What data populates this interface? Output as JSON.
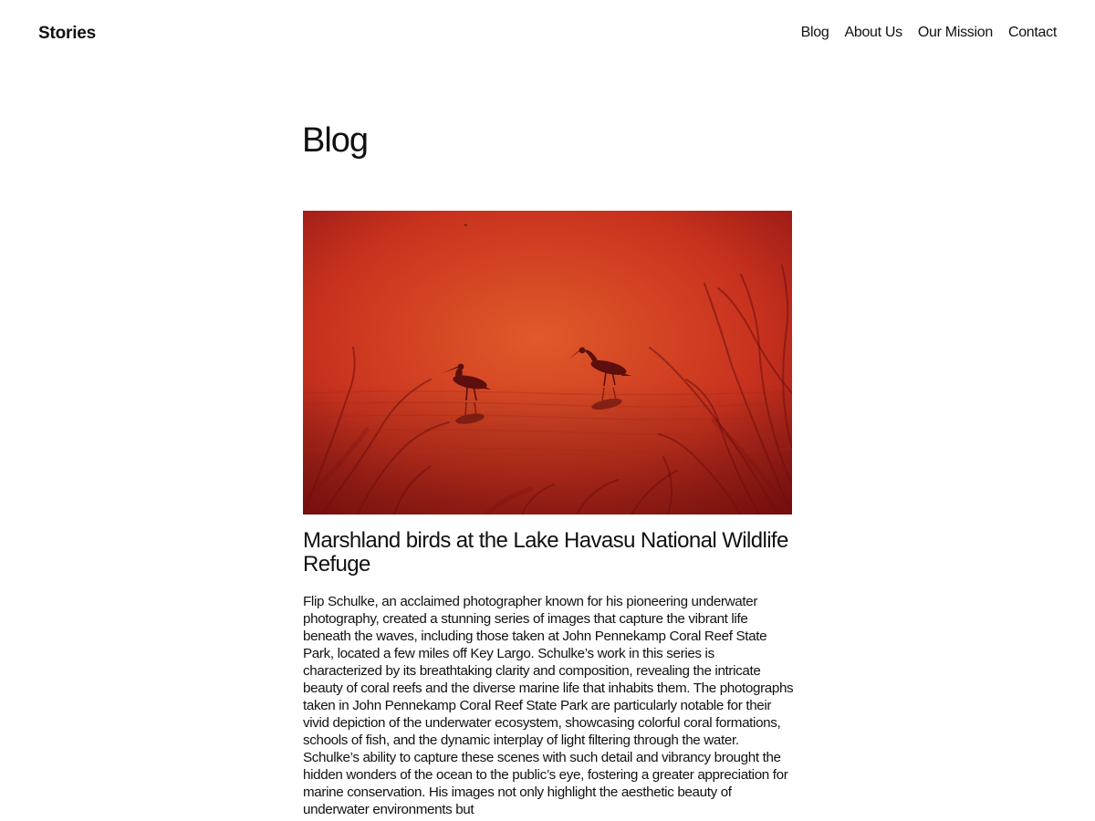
{
  "site": {
    "title": "Stories"
  },
  "nav": {
    "items": [
      {
        "label": "Blog"
      },
      {
        "label": "About Us"
      },
      {
        "label": "Our Mission"
      },
      {
        "label": "Contact"
      }
    ]
  },
  "page": {
    "title": "Blog"
  },
  "post": {
    "image": {
      "alt": "",
      "subject": "two wading birds silhouetted on water at sunset",
      "colors": {
        "light": "#e05a2a",
        "mid": "#c8321e",
        "dark": "#8e1414"
      }
    },
    "title": "Marshland birds at the Lake Havasu National Wildlife Refuge",
    "excerpt": "Flip Schulke, an acclaimed photographer known for his pioneering underwater photography, created a stunning series of images that capture the vibrant life beneath the waves, including those taken at John Pennekamp Coral Reef State Park, located a few miles off Key Largo. Schulke’s work in this series is characterized by its breathtaking clarity and composition, revealing the intricate beauty of coral reefs and the diverse marine life that inhabits them. The photographs taken in John Pennekamp Coral Reef State Park are particularly notable for their vivid depiction of the underwater ecosystem, showcasing colorful coral formations, schools of fish, and the dynamic interplay of light filtering through the water. Schulke’s ability to capture these scenes with such detail and vibrancy brought the hidden wonders of the ocean to the public’s eye, fostering a greater appreciation for marine conservation. His images not only highlight the aesthetic beauty of underwater environments but"
  }
}
